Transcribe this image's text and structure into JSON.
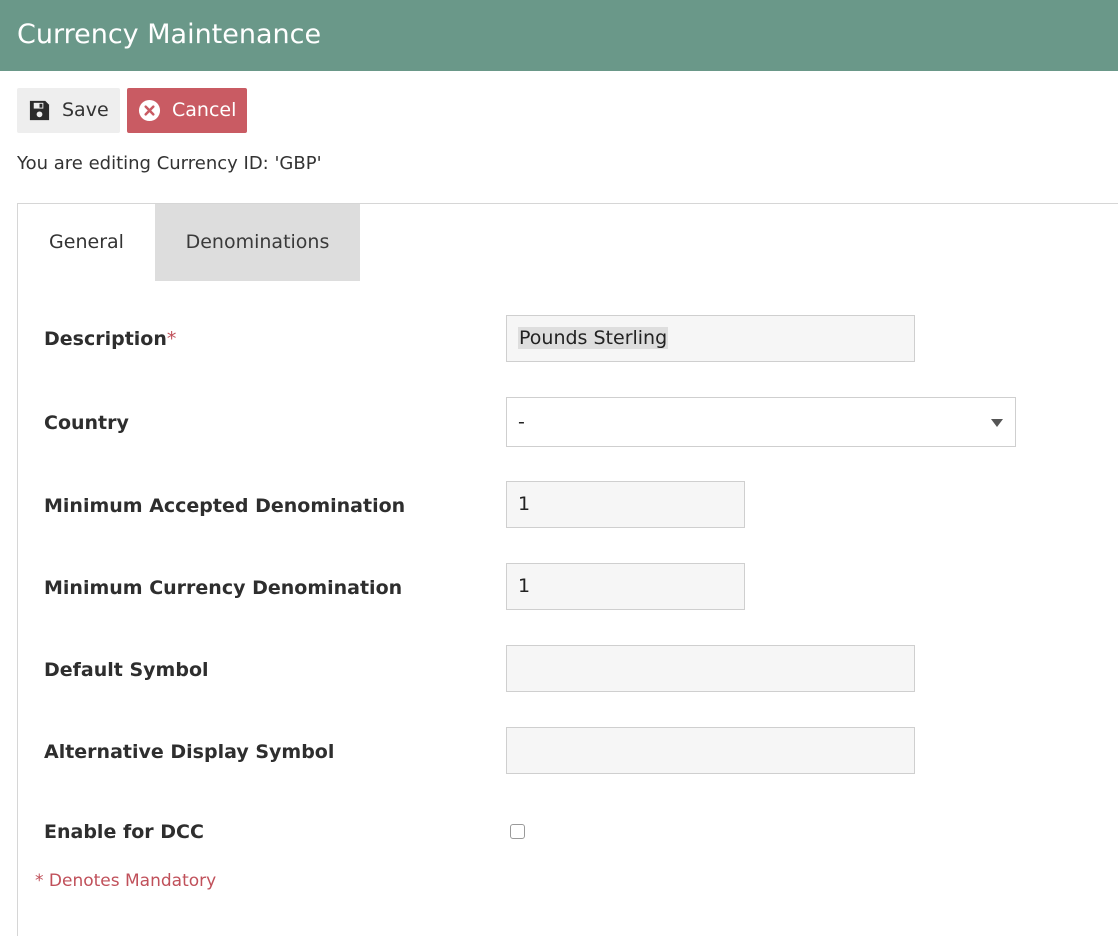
{
  "header": {
    "title": "Currency Maintenance",
    "background_color": "#6a9889"
  },
  "toolbar": {
    "save_label": "Save",
    "save_icon": "floppy-disk-icon",
    "cancel_label": "Cancel",
    "cancel_icon": "x-circle-icon",
    "cancel_color": "#c95b63"
  },
  "edit_note": "You are editing Currency ID: 'GBP'",
  "tabs": [
    {
      "label": "General",
      "active": true
    },
    {
      "label": "Denominations",
      "active": false
    }
  ],
  "form": {
    "description": {
      "label": "Description",
      "required_mark": "*",
      "value": "Pounds Sterling"
    },
    "country": {
      "label": "Country",
      "value": "-"
    },
    "min_accepted": {
      "label": "Minimum Accepted Denomination",
      "value": "1"
    },
    "min_currency": {
      "label": "Minimum Currency Denomination",
      "value": "1"
    },
    "default_symbol": {
      "label": "Default Symbol",
      "value": ""
    },
    "alt_symbol": {
      "label": "Alternative Display Symbol",
      "value": ""
    },
    "enable_dcc": {
      "label": "Enable for DCC",
      "checked": false
    }
  },
  "mandatory_note": "* Denotes Mandatory",
  "colors": {
    "required": "#c0505a",
    "inactive_tab": "#dddddd"
  }
}
